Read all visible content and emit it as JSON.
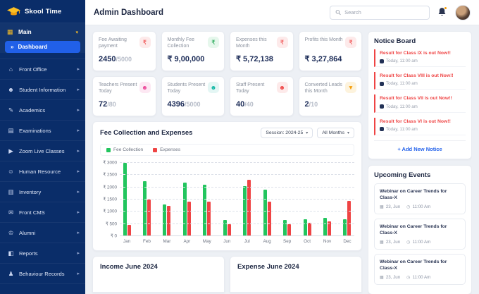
{
  "app": {
    "sidebar_bg": "#0a2d69",
    "accent_blue": "#2563eb",
    "green": "#22c55e",
    "red": "#ef4444",
    "yellow": "#fbbf24"
  },
  "icons": {
    "chevron_right": "▸",
    "chevron_down": "▾",
    "double_arrow": "»",
    "calendar": "▦",
    "clock": "◷"
  },
  "sidebar": {
    "logo_text": "Skool Time",
    "main": {
      "label": "Main",
      "icon": "▦"
    },
    "dashboard": {
      "label": "Dashboard"
    },
    "items": [
      {
        "label": "Front Office",
        "icon": "⌂"
      },
      {
        "label": "Student Information",
        "icon": "☻"
      },
      {
        "label": "Academics",
        "icon": "✎"
      },
      {
        "label": "Examinations",
        "icon": "▤"
      },
      {
        "label": "Zoom Live Classes",
        "icon": "▶"
      },
      {
        "label": "Human Resource",
        "icon": "☺"
      },
      {
        "label": "Inventory",
        "icon": "▥"
      },
      {
        "label": "Front CMS",
        "icon": "✉"
      },
      {
        "label": "Alumni",
        "icon": "♔"
      },
      {
        "label": "Reports",
        "icon": "◧"
      },
      {
        "label": "Behaviour Records",
        "icon": "♟"
      }
    ]
  },
  "header": {
    "title": "Admin Dashboard",
    "search_placeholder": "Search"
  },
  "stats": [
    {
      "label": "Fee Awaiting payment",
      "value": "2450",
      "suffix": "/5000",
      "icon": "₹",
      "icon_color": "#ef4444",
      "icon_bg": "#fdeaea"
    },
    {
      "label": "Monthly Fee Collection",
      "value": "₹ 9,00,000",
      "suffix": "",
      "icon": "₹",
      "icon_color": "#16a34a",
      "icon_bg": "#e6f7ec"
    },
    {
      "label": "Expenses this Month",
      "value": "₹ 5,72,138",
      "suffix": "",
      "icon": "₹",
      "icon_color": "#ef4444",
      "icon_bg": "#fdeaea"
    },
    {
      "label": "Profits this Month",
      "value": "₹ 3,27,864",
      "suffix": "",
      "icon": "₹",
      "icon_color": "#ef4444",
      "icon_bg": "#fdeaea"
    },
    {
      "label": "Teachers Present Today",
      "value": "72",
      "suffix": "/80",
      "icon": "☻",
      "icon_color": "#ec4899",
      "icon_bg": "#fde8f3"
    },
    {
      "label": "Students Present Today",
      "value": "4396",
      "suffix": "/5000",
      "icon": "☻",
      "icon_color": "#14b8a6",
      "icon_bg": "#e4f6f4"
    },
    {
      "label": "Staff Present Today",
      "value": "40",
      "suffix": "/40",
      "icon": "☻",
      "icon_color": "#ef4444",
      "icon_bg": "#fdeaea"
    },
    {
      "label": "Converted Leads this Month",
      "value": "2",
      "suffix": "/10",
      "icon": "▼",
      "icon_color": "#f59e0b",
      "icon_bg": "#fdf3dd"
    }
  ],
  "chart_card": {
    "session_filter": "Session: 2024-25",
    "month_filter": "All Months"
  },
  "chart_data": {
    "type": "bar",
    "title": "Fee Collection and Expenses",
    "categories": [
      "Jan",
      "Feb",
      "Mar",
      "Apr",
      "May",
      "Jun",
      "Jul",
      "Aug",
      "Sep",
      "Oct",
      "Nov",
      "Dec"
    ],
    "series": [
      {
        "name": "Fee Collection",
        "color": "#22c55e",
        "values": [
          3000,
          2250,
          1300,
          2200,
          2100,
          650,
          2050,
          1900,
          650,
          700,
          750,
          700
        ]
      },
      {
        "name": "Expenses",
        "color": "#ef4444",
        "values": [
          450,
          1500,
          1250,
          1400,
          1400,
          500,
          2300,
          1400,
          500,
          550,
          620,
          1430
        ]
      }
    ],
    "xlabel": "",
    "ylabel": "",
    "ylabel_prefix": "₹ ",
    "ylim": [
      0,
      3000
    ],
    "yticks": [
      0,
      500,
      1000,
      1500,
      2000,
      2500,
      3000
    ],
    "grid": "dashed horizontal",
    "legend_position": "top-left"
  },
  "bottom_cards": {
    "income_title": "Income June 2024",
    "expense_title": "Expense June 2024"
  },
  "notice_board": {
    "title": "Notice Board",
    "notices": [
      {
        "title": "Result for Class IX is out Now!!",
        "time": "Today, 11:00 am"
      },
      {
        "title": "Result for Class VIII is out Now!!",
        "time": "Today, 11:00 am"
      },
      {
        "title": "Result for Class VII is out Now!!",
        "time": "Today, 11:00 am"
      },
      {
        "title": "Result for Class VI is out Now!!",
        "time": "Today, 11:00 am"
      }
    ],
    "add_button": "+ Add New Notice"
  },
  "events": {
    "title": "Upcoming Events",
    "items": [
      {
        "title": "Webinar on Career Trends for Class-X",
        "date": "23, Jun",
        "time": "11:00 Am"
      },
      {
        "title": "Webinar on Career Trends for Class-X",
        "date": "23, Jun",
        "time": "11:00 Am"
      },
      {
        "title": "Webinar on Career Trends for Class-X",
        "date": "23, Jun",
        "time": "11:00 Am"
      }
    ]
  }
}
